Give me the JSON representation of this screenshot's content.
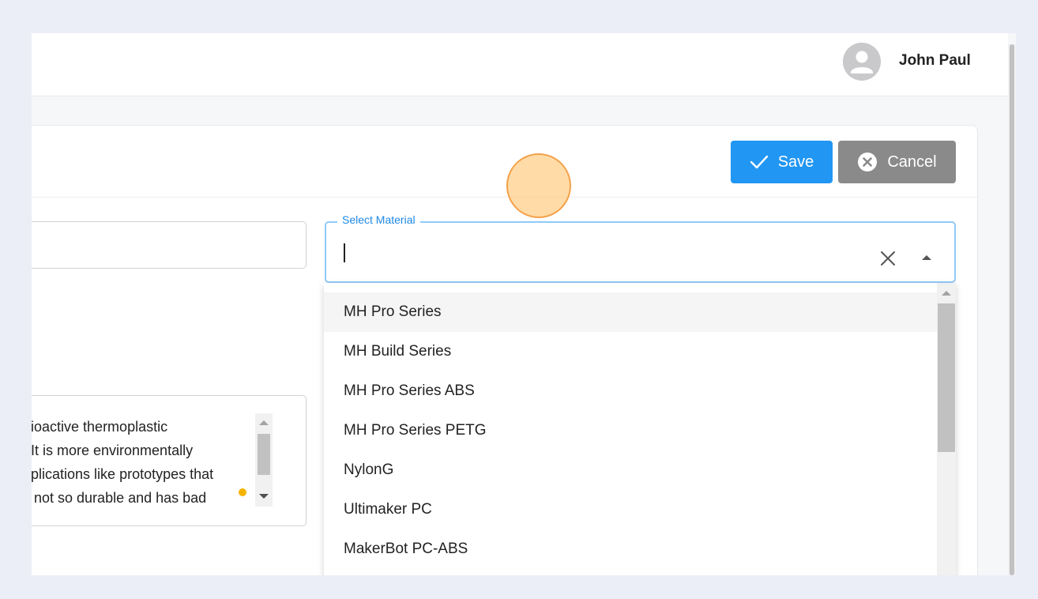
{
  "header": {
    "user_name": "John Paul",
    "avatar_icon": "person-icon"
  },
  "toolbar": {
    "save_label": "Save",
    "save_icon": "check-icon",
    "cancel_label": "Cancel",
    "cancel_icon": "circle-close-icon"
  },
  "description": {
    "lines": [
      "bioactive thermoplastic",
      ". It is more environmentally",
      "pplications like prototypes that",
      "s not so durable and has bad"
    ]
  },
  "material_select": {
    "label": "Select Material",
    "value": "",
    "options": [
      "MH Pro Series",
      "MH Build Series",
      "MH Pro Series ABS",
      "MH Pro Series PETG",
      "NylonG",
      "Ultimaker PC",
      "MakerBot PC-ABS"
    ],
    "highlighted_option": "MH Pro Series"
  },
  "colors": {
    "primary": "#2196f3",
    "cancel": "#8a8a8a",
    "focus_border": "#90caf9",
    "click_marker": "#f4a14a",
    "status_dot": "#f4b400"
  }
}
